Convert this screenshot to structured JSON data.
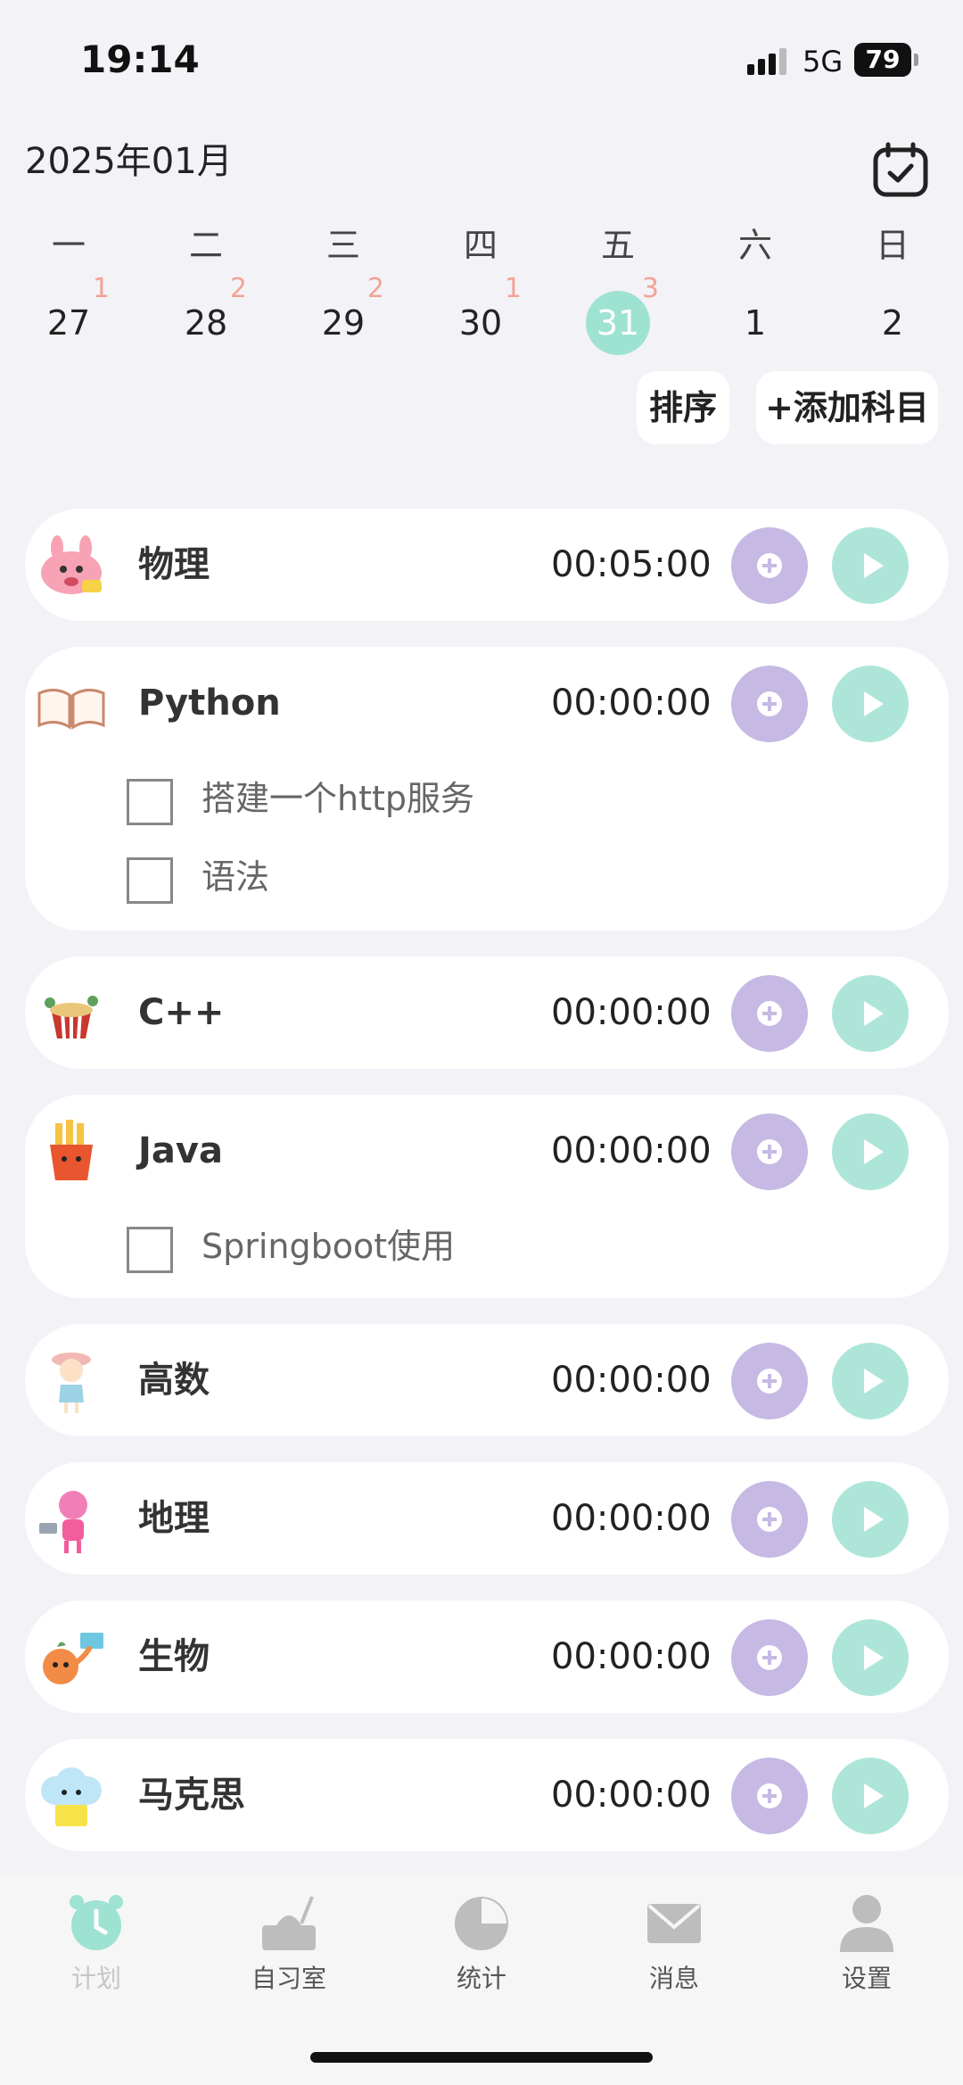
{
  "status_bar": {
    "time": "19:14",
    "network": "5G",
    "battery": "79"
  },
  "header": {
    "month_title": "2025年01月",
    "calendar_icon": "calendar-check-icon"
  },
  "week": {
    "weekdays": [
      "一",
      "二",
      "三",
      "四",
      "五",
      "六",
      "日"
    ],
    "dates": [
      {
        "day": "27",
        "count": "1"
      },
      {
        "day": "28",
        "count": "2"
      },
      {
        "day": "29",
        "count": "2"
      },
      {
        "day": "30",
        "count": "1"
      },
      {
        "day": "31",
        "count": "3",
        "selected": true
      },
      {
        "day": "1",
        "count": ""
      },
      {
        "day": "2",
        "count": ""
      }
    ]
  },
  "actions": {
    "sort_label": "排序",
    "add_label": "+添加科目"
  },
  "subjects": [
    {
      "name": "物理",
      "time": "00:05:00",
      "tasks": [],
      "avatar": "pink-monster-sticker"
    },
    {
      "name": "Python",
      "time": "00:00:00",
      "tasks": [
        "搭建一个http服务",
        "语法"
      ],
      "avatar": "open-book-icon"
    },
    {
      "name": "C++",
      "time": "00:00:00",
      "tasks": [],
      "avatar": "noodle-bowl-sticker"
    },
    {
      "name": "Java",
      "time": "00:00:00",
      "tasks": [
        "Springboot使用"
      ],
      "avatar": "fries-sticker"
    },
    {
      "name": "高数",
      "time": "00:00:00",
      "tasks": [],
      "avatar": "girl-sticker"
    },
    {
      "name": "地理",
      "time": "00:00:00",
      "tasks": [],
      "avatar": "pink-character-sticker"
    },
    {
      "name": "生物",
      "time": "00:00:00",
      "tasks": [],
      "avatar": "orange-character-sticker"
    },
    {
      "name": "马克思",
      "time": "00:00:00",
      "tasks": [],
      "avatar": "cloud-reading-sticker"
    }
  ],
  "bottom_nav": [
    {
      "label": "计划",
      "icon": "alarm-clock-icon",
      "active": true
    },
    {
      "label": "自习室",
      "icon": "desk-icon",
      "active": false
    },
    {
      "label": "统计",
      "icon": "pie-chart-icon",
      "active": false
    },
    {
      "label": "消息",
      "icon": "envelope-icon",
      "active": false
    },
    {
      "label": "设置",
      "icon": "person-icon",
      "active": false
    }
  ],
  "colors": {
    "accent_green": "#9EE2D2",
    "accent_purple": "#C6B9E4",
    "count_badge": "#F2A497",
    "background": "#F3F2F7"
  }
}
